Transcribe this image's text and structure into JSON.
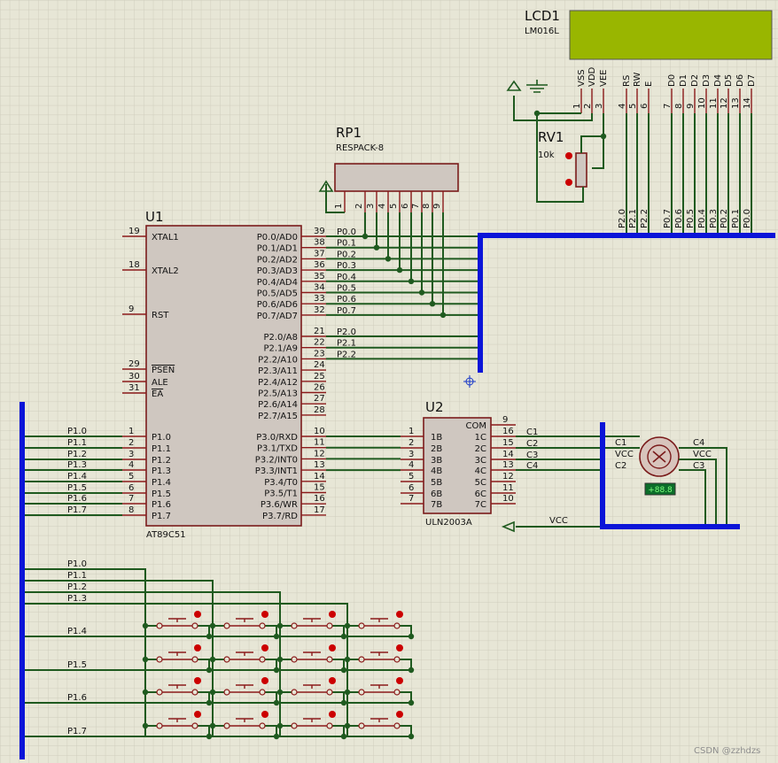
{
  "lcd": {
    "ref": "LCD1",
    "model": "LM016L",
    "pins": [
      {
        "name": "VSS",
        "num": "1"
      },
      {
        "name": "VDD",
        "num": "2"
      },
      {
        "name": "VEE",
        "num": "3"
      },
      {
        "name": "RS",
        "num": "4"
      },
      {
        "name": "RW",
        "num": "5"
      },
      {
        "name": "E",
        "num": "6"
      },
      {
        "name": "D0",
        "num": "7"
      },
      {
        "name": "D1",
        "num": "8"
      },
      {
        "name": "D2",
        "num": "9"
      },
      {
        "name": "D3",
        "num": "10"
      },
      {
        "name": "D4",
        "num": "11"
      },
      {
        "name": "D5",
        "num": "12"
      },
      {
        "name": "D6",
        "num": "13"
      },
      {
        "name": "D7",
        "num": "14"
      }
    ],
    "nets": [
      "P2.0",
      "P2.1",
      "P2.2",
      "P0.7",
      "P0.6",
      "P0.5",
      "P0.4",
      "P0.3",
      "P0.2",
      "P0.1",
      "P0.0"
    ]
  },
  "rv1": {
    "ref": "RV1",
    "value": "10k"
  },
  "rp1": {
    "ref": "RP1",
    "model": "RESPACK-8",
    "pins": [
      "1",
      "2",
      "3",
      "4",
      "5",
      "6",
      "7",
      "8",
      "9"
    ]
  },
  "u1": {
    "ref": "U1",
    "model": "AT89C51",
    "left_pins": [
      {
        "num": "19",
        "name": "XTAL1"
      },
      {
        "num": "18",
        "name": "XTAL2"
      },
      {
        "num": "9",
        "name": "RST"
      },
      {
        "num": "29",
        "name": "PSEN"
      },
      {
        "num": "30",
        "name": "ALE"
      },
      {
        "num": "31",
        "name": "EA"
      },
      {
        "num": "1",
        "name": "P1.0"
      },
      {
        "num": "2",
        "name": "P1.1"
      },
      {
        "num": "3",
        "name": "P1.2"
      },
      {
        "num": "4",
        "name": "P1.3"
      },
      {
        "num": "5",
        "name": "P1.4"
      },
      {
        "num": "6",
        "name": "P1.5"
      },
      {
        "num": "7",
        "name": "P1.6"
      },
      {
        "num": "8",
        "name": "P1.7"
      }
    ],
    "right_pins": [
      {
        "num": "39",
        "name": "P0.0/AD0"
      },
      {
        "num": "38",
        "name": "P0.1/AD1"
      },
      {
        "num": "37",
        "name": "P0.2/AD2"
      },
      {
        "num": "36",
        "name": "P0.3/AD3"
      },
      {
        "num": "35",
        "name": "P0.4/AD4"
      },
      {
        "num": "34",
        "name": "P0.5/AD5"
      },
      {
        "num": "33",
        "name": "P0.6/AD6"
      },
      {
        "num": "32",
        "name": "P0.7/AD7"
      },
      {
        "num": "21",
        "name": "P2.0/A8"
      },
      {
        "num": "22",
        "name": "P2.1/A9"
      },
      {
        "num": "23",
        "name": "P2.2/A10"
      },
      {
        "num": "24",
        "name": "P2.3/A11"
      },
      {
        "num": "25",
        "name": "P2.4/A12"
      },
      {
        "num": "26",
        "name": "P2.5/A13"
      },
      {
        "num": "27",
        "name": "P2.6/A14"
      },
      {
        "num": "28",
        "name": "P2.7/A15"
      },
      {
        "num": "10",
        "name": "P3.0/RXD"
      },
      {
        "num": "11",
        "name": "P3.1/TXD"
      },
      {
        "num": "12",
        "name": "P3.2/INT0"
      },
      {
        "num": "13",
        "name": "P3.3/INT1"
      },
      {
        "num": "14",
        "name": "P3.4/T0"
      },
      {
        "num": "15",
        "name": "P3.5/T1"
      },
      {
        "num": "16",
        "name": "P3.6/WR"
      },
      {
        "num": "17",
        "name": "P3.7/RD"
      }
    ],
    "p0_nets": [
      "P0.0",
      "P0.1",
      "P0.2",
      "P0.3",
      "P0.4",
      "P0.5",
      "P0.6",
      "P0.7"
    ],
    "p2_nets": [
      "P2.0",
      "P2.1",
      "P2.2"
    ],
    "p1_nets": [
      "P1.0",
      "P1.1",
      "P1.2",
      "P1.3",
      "P1.4",
      "P1.5",
      "P1.6",
      "P1.7"
    ]
  },
  "u2": {
    "ref": "U2",
    "model": "ULN2003A",
    "left_pins": [
      {
        "num": "1",
        "name": "1B"
      },
      {
        "num": "2",
        "name": "2B"
      },
      {
        "num": "3",
        "name": "3B"
      },
      {
        "num": "4",
        "name": "4B"
      },
      {
        "num": "5",
        "name": "5B"
      },
      {
        "num": "6",
        "name": "6B"
      },
      {
        "num": "7",
        "name": "7B"
      }
    ],
    "right_pins": [
      {
        "num": "9",
        "name": "COM"
      },
      {
        "num": "16",
        "name": "1C"
      },
      {
        "num": "15",
        "name": "2C"
      },
      {
        "num": "14",
        "name": "3C"
      },
      {
        "num": "13",
        "name": "4C"
      },
      {
        "num": "12",
        "name": "5C"
      },
      {
        "num": "11",
        "name": "6C"
      },
      {
        "num": "10",
        "name": "7C"
      }
    ],
    "out_nets": [
      "C1",
      "C2",
      "C3",
      "C4"
    ]
  },
  "motor": {
    "readout": "+88.8",
    "labels": [
      "C1",
      "VCC",
      "C2",
      "C4",
      "VCC",
      "C3"
    ]
  },
  "keypad": {
    "row_nets": [
      "P1.4",
      "P1.5",
      "P1.6",
      "P1.7"
    ],
    "col_nets": [
      "P1.0",
      "P1.1",
      "P1.2",
      "P1.3"
    ]
  },
  "vcc": {
    "label": "VCC"
  },
  "watermark": "CSDN @zzhdzs",
  "colors": {
    "wire": "#1f5a1f",
    "bus": "#0a14d8",
    "body": "#cfc7c0",
    "outline": "#7a1b1b",
    "lcd": "#99b600"
  }
}
